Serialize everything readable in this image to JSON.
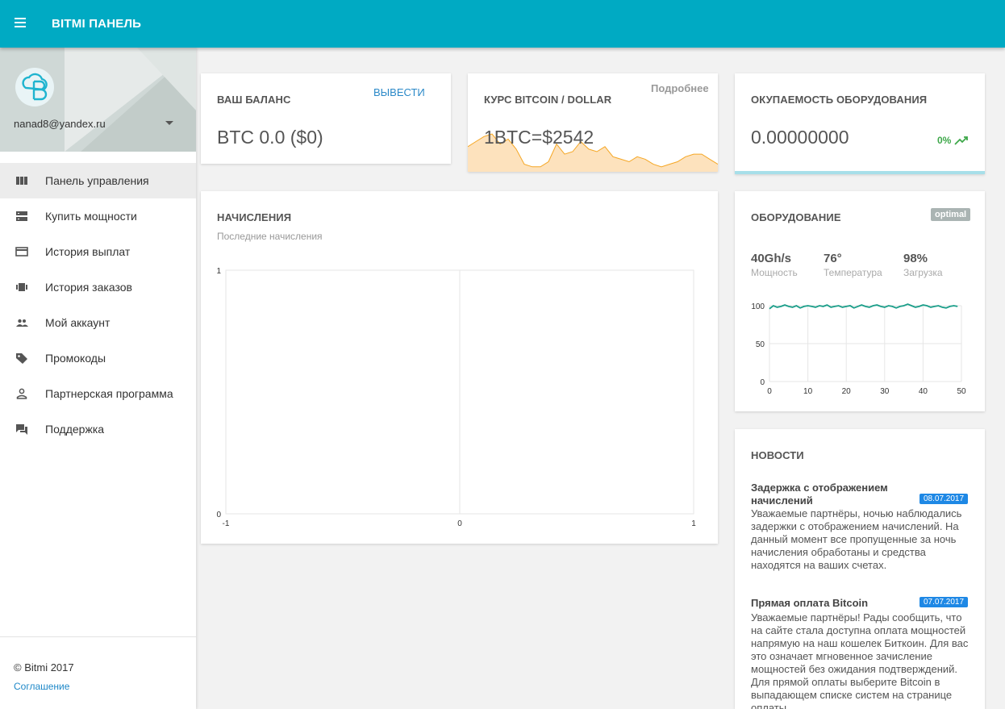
{
  "header": {
    "title": "BITMI ПАНЕЛЬ",
    "menu_icon": "hamburger-icon"
  },
  "user": {
    "email": "nanad8@yandex.ru",
    "avatar_icon": "cloud-b-logo-icon"
  },
  "sidebar": {
    "items": [
      {
        "label": "Панель управления",
        "icon": "dashboard-icon",
        "active": true
      },
      {
        "label": "Купить мощности",
        "icon": "server-icon",
        "active": false
      },
      {
        "label": "История выплат",
        "icon": "credit-card-icon",
        "active": false
      },
      {
        "label": "История заказов",
        "icon": "orders-icon",
        "active": false
      },
      {
        "label": "Мой аккаунт",
        "icon": "people-icon",
        "active": false
      },
      {
        "label": "Промокоды",
        "icon": "tag-icon",
        "active": false
      },
      {
        "label": "Партнерская программа",
        "icon": "person-icon",
        "active": false
      },
      {
        "label": "Поддержка",
        "icon": "chat-icon",
        "active": false
      }
    ],
    "copyright": "© Bitmi 2017",
    "agreement": "Соглашение"
  },
  "balance": {
    "title": "ВАШ БАЛАНС",
    "withdraw": "ВЫВЕСТИ",
    "value": "BTC 0.0 ($0)"
  },
  "rate": {
    "title": "КУРС BITCOIN / DOLLAR",
    "more": "Подробнее",
    "value": "1BTC=$2542"
  },
  "payback": {
    "title": "ОКУПАЕМОСТЬ ОБОРУДОВАНИЯ",
    "value": "0.00000000",
    "percent": "0%",
    "trend_icon": "trending-up-icon"
  },
  "accruals": {
    "title": "НАЧИСЛЕНИЯ",
    "subtitle": "Последние начисления",
    "chart_data": {
      "type": "line",
      "x": [],
      "series": [],
      "xlim": [
        -1,
        1
      ],
      "ylim": [
        0,
        1
      ],
      "x_ticks": [
        "-1",
        "0",
        "1"
      ],
      "y_ticks": [
        "0",
        "1"
      ],
      "grid": true
    }
  },
  "equipment": {
    "title": "ОБОРУДОВАНИЕ",
    "badge": "optimal",
    "stats": [
      {
        "value": "40Gh/s",
        "label": "Мощность"
      },
      {
        "value": "76°",
        "label": "Температура"
      },
      {
        "value": "98%",
        "label": "Загрузка"
      }
    ],
    "chart_data": {
      "type": "line",
      "x": [
        0,
        1,
        2,
        3,
        4,
        5,
        6,
        7,
        8,
        9,
        10,
        11,
        12,
        13,
        14,
        15,
        16,
        17,
        18,
        19,
        20,
        21,
        22,
        23,
        24,
        25,
        26,
        27,
        28,
        29,
        30,
        31,
        32,
        33,
        34,
        35,
        36,
        37,
        38,
        39,
        40,
        41,
        42,
        43,
        44,
        45,
        46,
        47,
        48,
        49
      ],
      "series": [
        {
          "values": [
            96,
            100,
            98,
            99,
            101,
            99,
            98,
            100,
            97,
            99,
            100,
            99,
            98,
            100,
            99,
            101,
            98,
            99,
            100,
            98,
            99,
            100,
            97,
            99,
            101,
            99,
            98,
            100,
            101,
            99,
            98,
            100,
            99,
            97,
            99,
            100,
            102,
            100,
            98,
            99,
            101,
            100,
            98,
            99,
            100,
            98,
            97,
            99,
            100,
            99
          ],
          "color": "#1a9e89"
        }
      ],
      "xlim": [
        0,
        50
      ],
      "ylim": [
        0,
        100
      ],
      "x_ticks": [
        "0",
        "10",
        "20",
        "30",
        "40",
        "50"
      ],
      "y_ticks": [
        "0",
        "50",
        "100"
      ],
      "grid": true
    }
  },
  "rate_chart": {
    "chart_data": {
      "type": "area",
      "x": [
        0,
        1,
        2,
        3,
        4,
        5,
        6,
        7,
        8,
        9,
        10,
        11,
        12,
        13,
        14,
        15,
        16,
        17,
        18,
        19,
        20,
        21,
        22,
        23,
        24,
        25,
        26,
        27,
        28,
        29,
        30,
        31
      ],
      "series": [
        {
          "values": [
            20,
            24,
            28,
            30,
            22,
            26,
            18,
            6,
            4,
            4,
            8,
            22,
            14,
            16,
            24,
            18,
            16,
            20,
            12,
            10,
            8,
            12,
            10,
            6,
            4,
            6,
            8,
            12,
            14,
            14,
            10,
            6
          ],
          "color": "#f5a623"
        }
      ]
    }
  },
  "news": {
    "title": "НОВОСТИ",
    "items": [
      {
        "title": "Задержка с отображением начислений",
        "date": "08.07.2017",
        "body": "Уважаемые партнёры, ночью наблюдались задержки с отображением начислений. На данный момент все пропущенные за ночь начисления обработаны и средства находятся на ваших счетах."
      },
      {
        "title": "Прямая оплата Bitcoin",
        "date": "07.07.2017",
        "body": "Уважаемые партнёры! Рады сообщить, что на сайте стала доступна оплата мощностей напрямую на наш кошелек Биткоин. Для вас это означает мгновенное зачисление мощностей без ожидания подтверждений. Для прямой оплаты выберите Bitcoin в выпадающем списке систем на странице оплаты."
      }
    ]
  }
}
